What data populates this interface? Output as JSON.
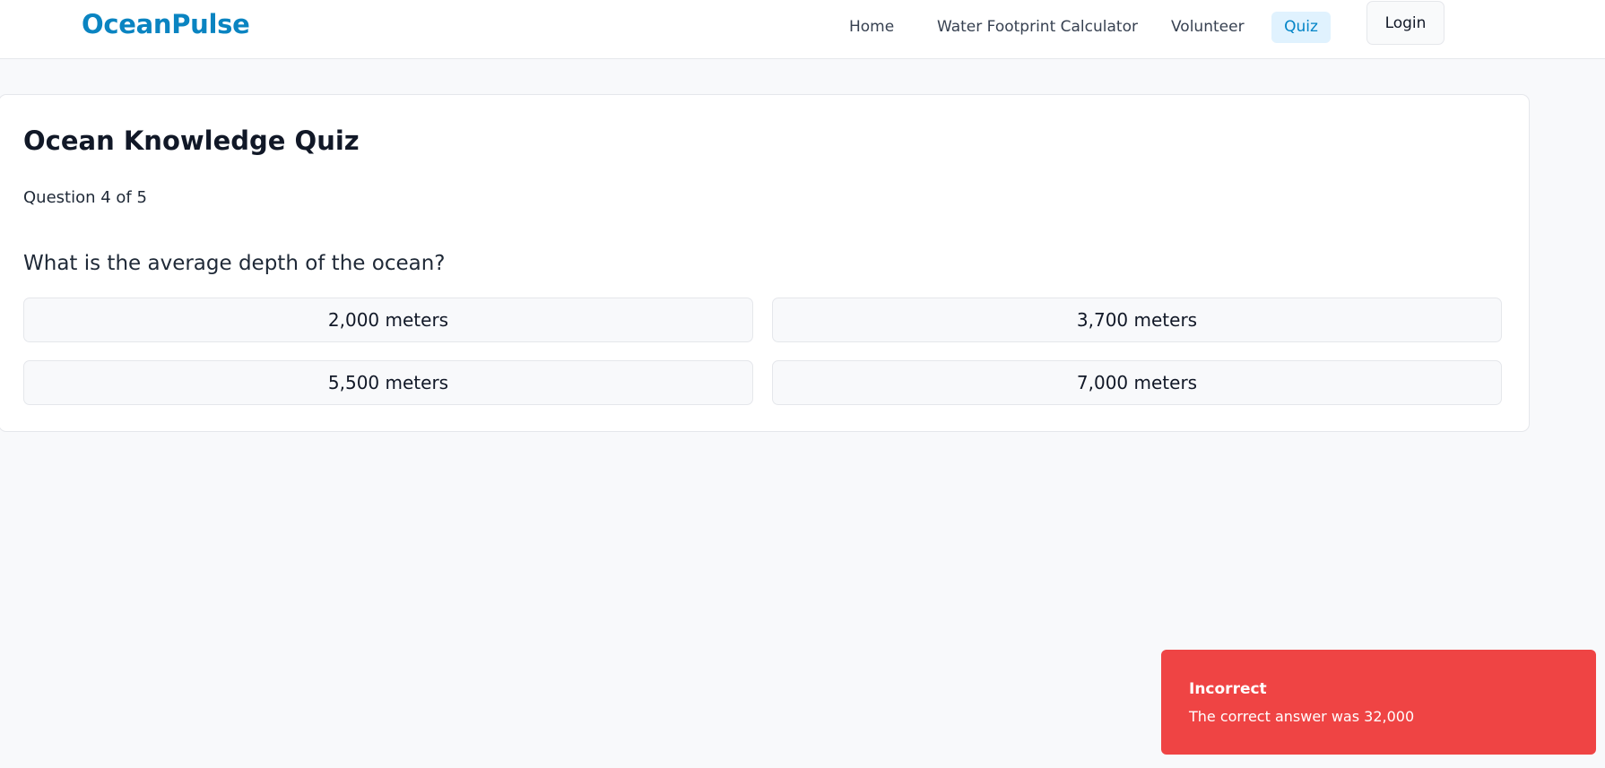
{
  "header": {
    "brand": "OceanPulse",
    "nav": [
      "Home",
      "Water Footprint Calculator",
      "Volunteer",
      "Quiz"
    ],
    "active_nav": "Quiz",
    "login_label": "Login"
  },
  "quiz": {
    "title": "Ocean Knowledge Quiz",
    "progress": "Question 4 of 5",
    "question": "What is the average depth of the ocean?",
    "answers": [
      "2,000 meters",
      "3,700 meters",
      "5,500 meters",
      "7,000 meters"
    ]
  },
  "toast": {
    "title": "Incorrect",
    "message": "The correct answer was 32,000"
  },
  "colors": {
    "brand": "#0a84c1",
    "active_nav_bg": "#e0f2fe",
    "toast_bg": "#ef4444"
  }
}
